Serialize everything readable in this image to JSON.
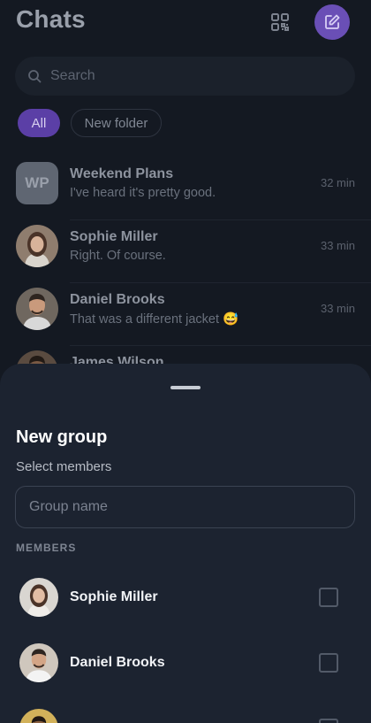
{
  "header": {
    "title": "Chats"
  },
  "search": {
    "placeholder": "Search"
  },
  "folders": [
    {
      "label": "All",
      "active": true
    },
    {
      "label": "New folder",
      "active": false
    }
  ],
  "chats": [
    {
      "name": "Weekend Plans",
      "message": "I've heard it's pretty good.",
      "time": "32 min",
      "avatar_initials": "WP"
    },
    {
      "name": "Sophie Miller",
      "message": "Right. Of course.",
      "time": "33 min"
    },
    {
      "name": "Daniel Brooks",
      "message": "That was a different jacket 😅",
      "time": "33 min"
    },
    {
      "name": "James Wilson",
      "message": "",
      "time": ""
    }
  ],
  "sheet": {
    "title": "New group",
    "subtitle": "Select members",
    "group_name_placeholder": "Group name",
    "members_label": "MEMBERS",
    "members": [
      {
        "name": "Sophie Miller",
        "selected": false
      },
      {
        "name": "Daniel Brooks",
        "selected": false
      },
      {
        "name": "",
        "selected": false
      }
    ]
  },
  "colors": {
    "accent": "#6a4fb6",
    "background": "#141922",
    "sheet": "#1c2330"
  }
}
